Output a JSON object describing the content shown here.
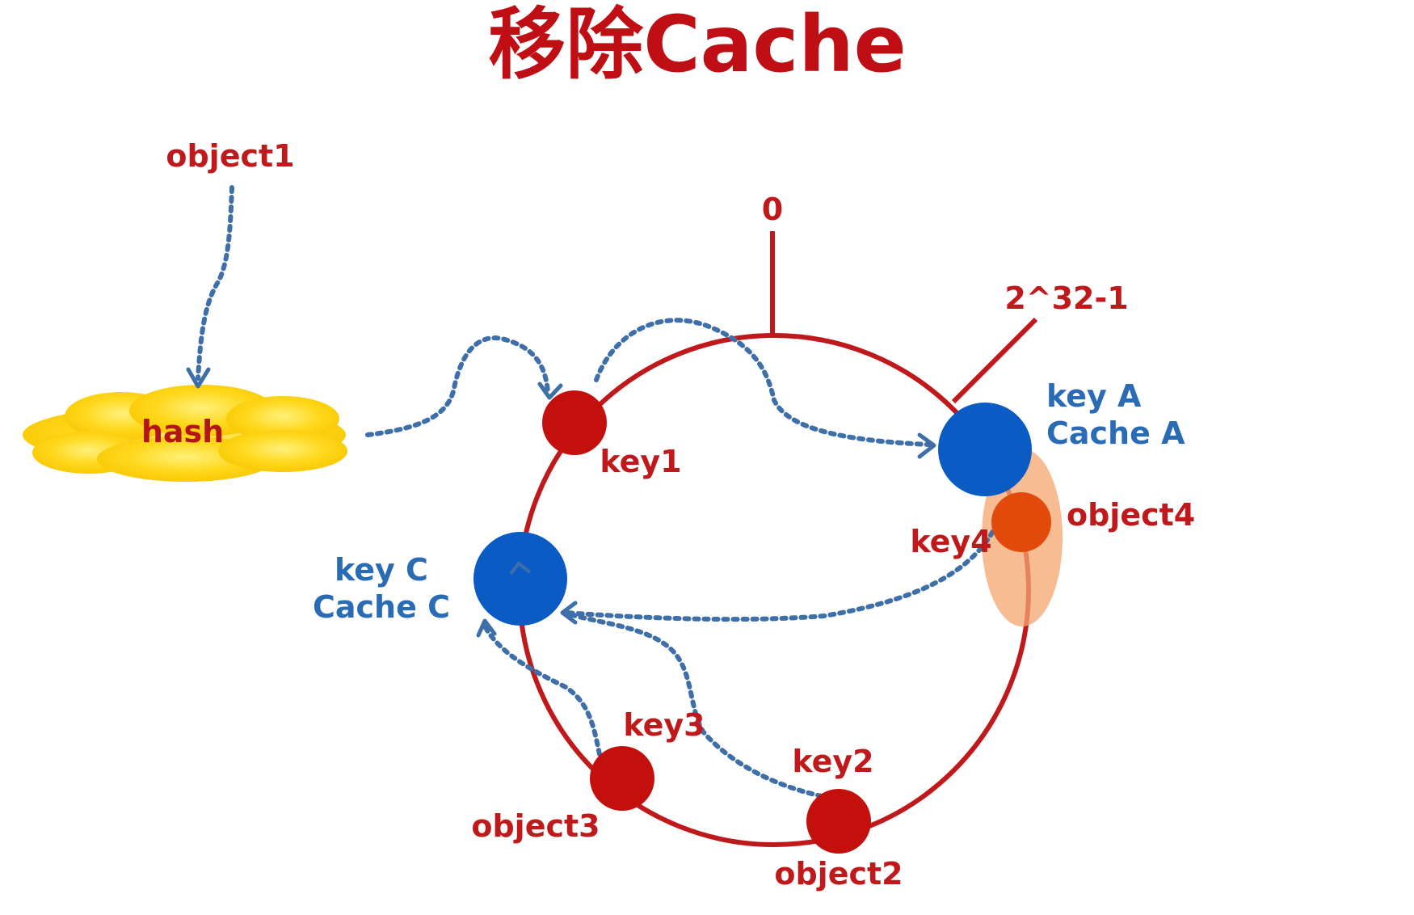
{
  "title": "移除Cache",
  "ring": {
    "zero_label": "0",
    "max_label": "2^32-1"
  },
  "source": {
    "object_label": "object1",
    "hash_label": "hash"
  },
  "caches": {
    "a": {
      "key": "key A",
      "name": "Cache A"
    },
    "c": {
      "key": "key C",
      "name": "Cache C"
    }
  },
  "keys": {
    "key1": "key1",
    "key2": "key2",
    "key3": "key3",
    "key4": "key4"
  },
  "objects": {
    "object2": "object2",
    "object3": "object3",
    "object4": "object4"
  },
  "colors": {
    "ring": "#c0191c",
    "key_node": "#c4100d",
    "cache_node": "#0a5bc4",
    "removed_highlight": "#f5a66e",
    "object4_node": "#e24a0b",
    "cloud": "#ffd21c",
    "arrow": "#3f6fa8"
  }
}
